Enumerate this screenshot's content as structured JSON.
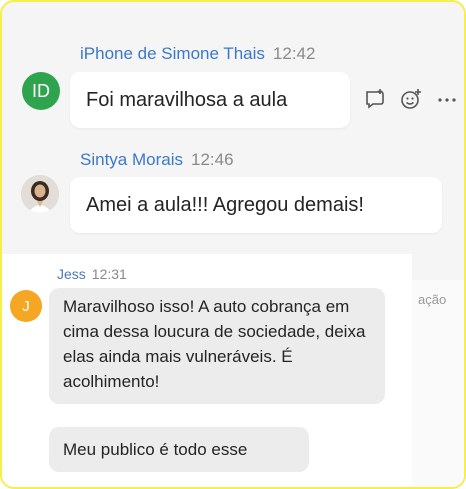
{
  "messages": [
    {
      "sender": "iPhone de Simone Thais",
      "time": "12:42",
      "avatar_initials": "ID",
      "text": "Foi maravilhosa a aula"
    },
    {
      "sender": "Sintya Morais",
      "time": "12:46",
      "text": "Amei a aula!!! Agregou demais!"
    }
  ],
  "reply": {
    "sender": "Jess",
    "time": "12:31",
    "avatar_initial": "J",
    "text": "Maravilhoso isso! A auto cobrança em cima dessa loucura de sociedade, deixa elas ainda mais vulneráveis. É acolhimento!",
    "text2": "Meu publico é todo esse",
    "cut_text": "ação"
  },
  "icons": {
    "reply": "reply-icon",
    "react": "add-reaction-icon",
    "more": "more-options-icon"
  },
  "colors": {
    "frame_border": "#f5ef4a",
    "sender_name": "#3b78c9",
    "avatar_id": "#2ea44f",
    "avatar_j": "#f5a623"
  }
}
